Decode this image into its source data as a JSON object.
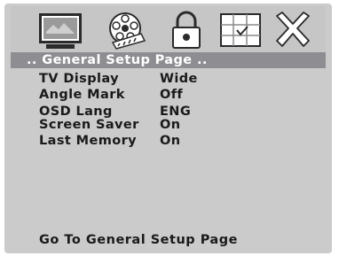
{
  "icons": [
    {
      "name": "tv-screen-icon"
    },
    {
      "name": "film-reel-icon"
    },
    {
      "name": "padlock-icon"
    },
    {
      "name": "grid-display-icon"
    },
    {
      "name": "close-x-icon"
    }
  ],
  "title": ".. General Setup Page ..",
  "menu_items": [
    {
      "label": "TV  Display",
      "value": "Wide"
    },
    {
      "label": "Angle  Mark",
      "value": "Off"
    },
    {
      "label": "OSD  Lang",
      "value": "ENG"
    },
    {
      "label": "Screen  Saver",
      "value": "On"
    },
    {
      "label": "Last  Memory",
      "value": "On"
    }
  ],
  "status": "Go  To  General  Setup  Page",
  "colors": {
    "panel": "#cbcbcb",
    "title_bar": "#8e8e92",
    "icon_selected_fill": "#dcdcdc"
  }
}
